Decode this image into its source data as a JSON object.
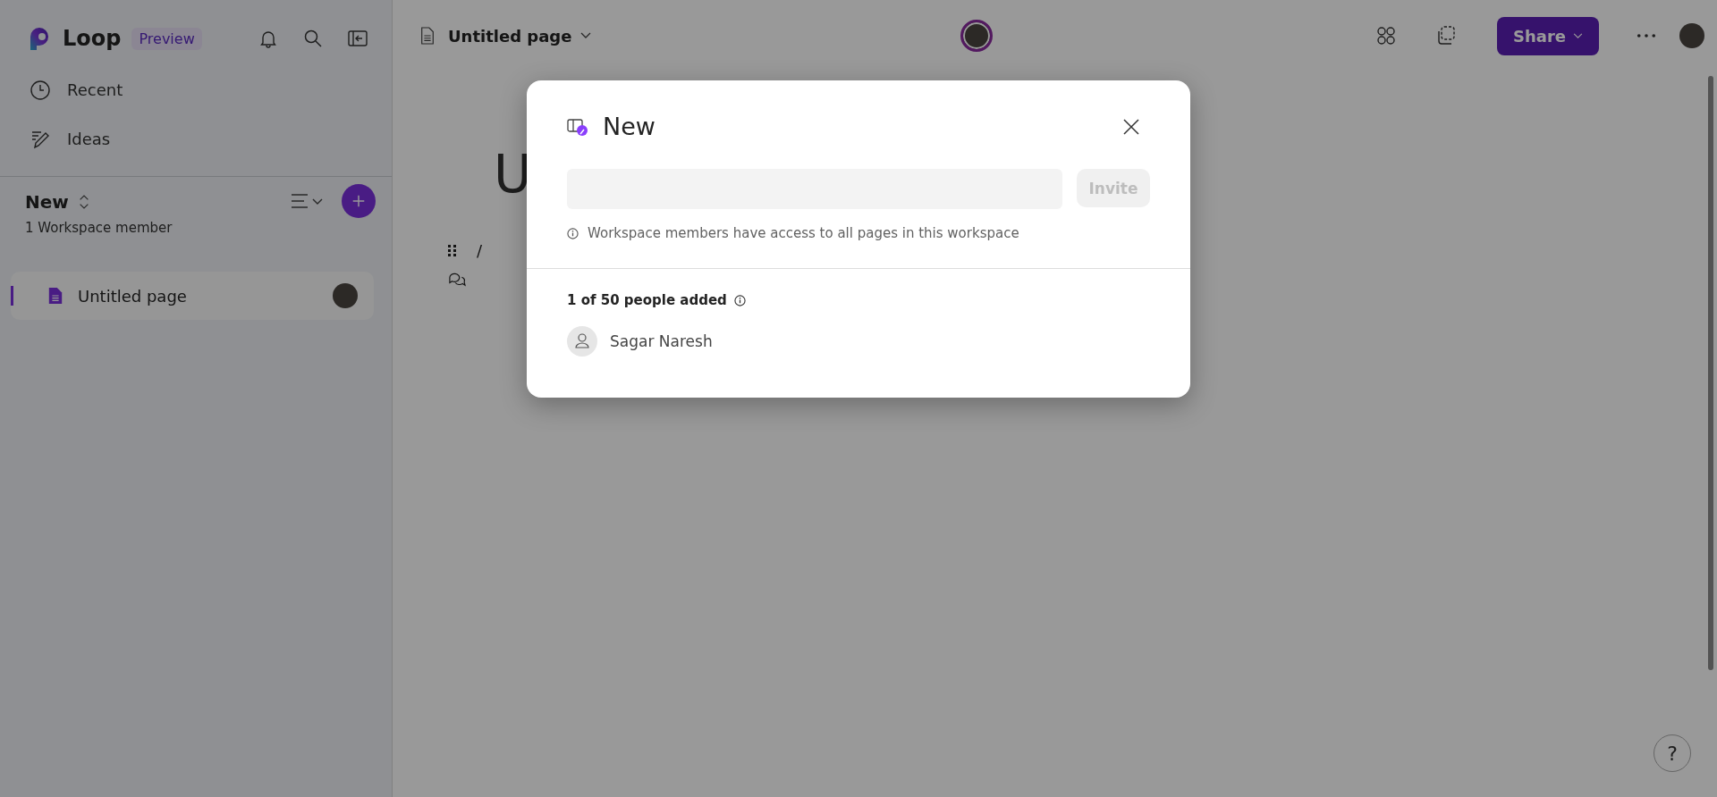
{
  "sidebar": {
    "brand": "Loop",
    "badge": "Preview",
    "nav": [
      {
        "label": "Recent",
        "kind": "recent"
      },
      {
        "label": "Ideas",
        "kind": "ideas"
      }
    ],
    "workspace": {
      "name": "New",
      "members": "1 Workspace member"
    },
    "pages": [
      {
        "title": "Untitled page",
        "selected": true
      }
    ]
  },
  "topbar": {
    "page_title": "Untitled page",
    "share": "Share"
  },
  "editor": {
    "title": "U",
    "slash": "/"
  },
  "dialog": {
    "title": "New",
    "invite_button": {
      "label": "Invite",
      "disabled": true
    },
    "info": "Workspace members have access to all pages in this workspace",
    "count": "1 of 50 people added",
    "people": [
      {
        "name": "Sagar Naresh"
      }
    ]
  },
  "help": "?"
}
